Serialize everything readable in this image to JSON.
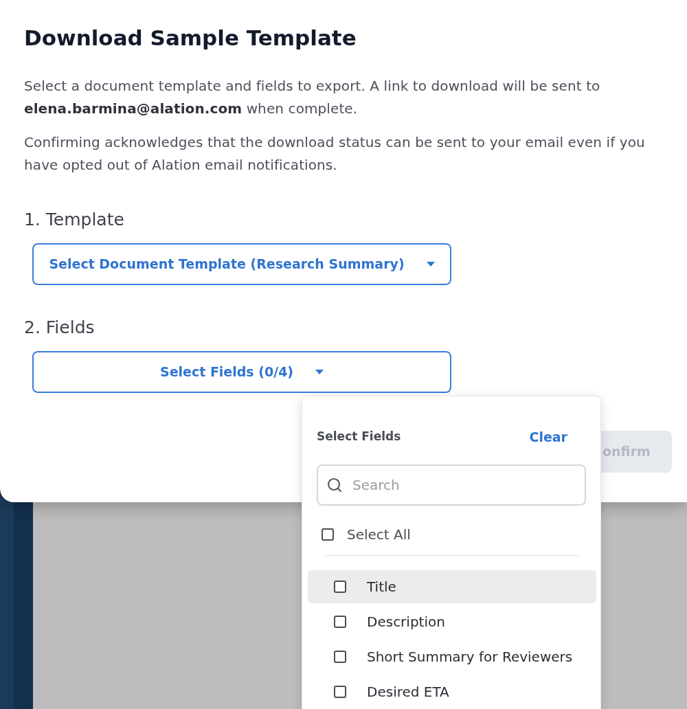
{
  "dialog": {
    "title": "Download Sample Template",
    "paragraphs": [
      "Select a document template and fields to export. A link to download will be sent to **elena.barmina@alation.com** when complete.",
      "Confirming acknowledges that the download status can be sent to your email even if you have opted out of Alation email notifications."
    ]
  },
  "sections": [
    {
      "heading": "1. Template",
      "dropdown": {
        "label": "Select Document Template (Research Summary)"
      }
    },
    {
      "heading": "2. Fields",
      "dropdown": {
        "label": "Select Fields (0/4)"
      }
    }
  ],
  "confirm_button": {
    "label": "onfirm",
    "disabled": true
  },
  "fields_menu": {
    "title": "Select Fields",
    "clear": "Clear",
    "search": {
      "placeholder": "Search"
    },
    "select_all": {
      "label": "Select All",
      "checked": false
    },
    "items": [
      {
        "label": "Title",
        "checked": false,
        "highlighted": true
      },
      {
        "label": "Description",
        "checked": false,
        "highlighted": false
      },
      {
        "label": "Short Summary for Reviewers",
        "checked": false,
        "highlighted": false
      },
      {
        "label": "Desired ETA",
        "checked": false,
        "highlighted": false
      }
    ]
  }
}
